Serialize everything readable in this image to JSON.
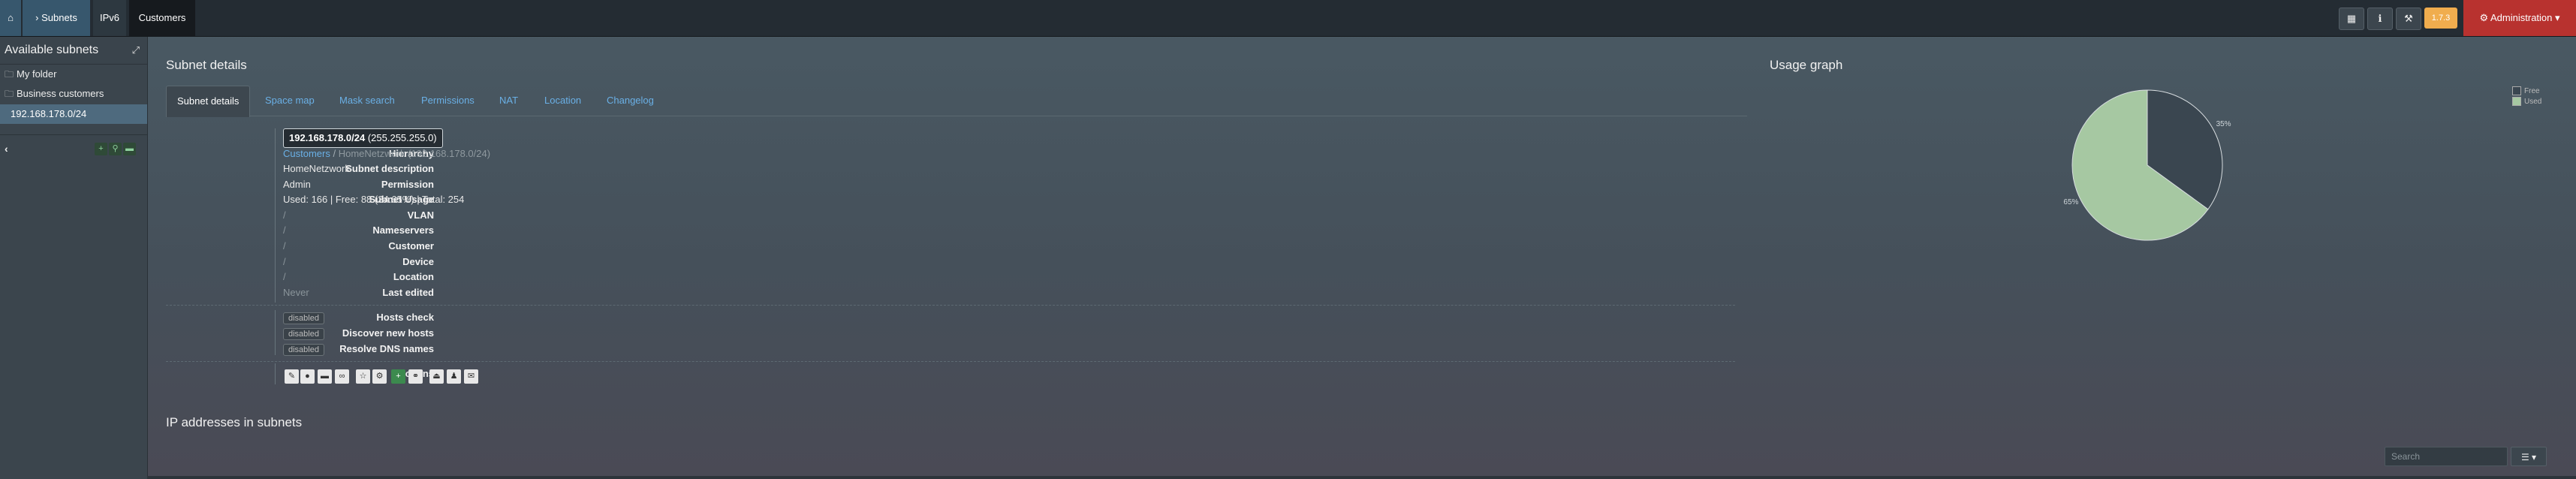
{
  "nav": {
    "home_icon": "home-icon",
    "subnets_label": "› Subnets",
    "ipv6_label": "IPv6",
    "customers_label": "Customers",
    "version_label": "1.7.3",
    "admin_label": "Administration ▾",
    "icons": [
      "grid-icon",
      "info-icon",
      "wrench-icon"
    ]
  },
  "sidebar": {
    "title": "Available subnets",
    "items": [
      {
        "label": "My folder",
        "icon": "folder-icon"
      },
      {
        "label": "Business customers",
        "icon": "folder-icon"
      },
      {
        "label": "192.168.178.0/24",
        "selected": true
      }
    ]
  },
  "details": {
    "title": "Subnet details",
    "tabs": [
      "Subnet details",
      "Space map",
      "Mask search",
      "Permissions",
      "NAT",
      "Location",
      "Changelog"
    ],
    "rows": {
      "subnet_details_label": "Subnet details",
      "cidr": "192.168.178.0/24",
      "mask": "(255.255.255.0)",
      "hierarchy_label": "Hierarchy",
      "hierarchy_link": "Customers",
      "hierarchy_sep": "/",
      "hierarchy_rest": "HomeNetzwork (192.168.178.0/24)",
      "description_label": "Subnet description",
      "description": "HomeNetzwork",
      "permission_label": "Permission",
      "permission": "Admin",
      "usage_label": "Subnet Usage",
      "usage": "Used: 166 | Free: 88 (34.65%) | Total: 254",
      "vlan_label": "VLAN",
      "vlan": "/",
      "nameservers_label": "Nameservers",
      "nameservers": "/",
      "customer_label": "Customer",
      "customer": "/",
      "device_label": "Device",
      "device": "/",
      "location_label": "Location",
      "location": "/",
      "last_edited_label": "Last edited",
      "last_edited": "Never",
      "hosts_check_label": "Hosts check",
      "hosts_check": "disabled",
      "discover_label": "Discover new hosts",
      "discover": "disabled",
      "resolve_label": "Resolve DNS names",
      "resolve": "disabled",
      "actions_label": "Actions"
    }
  },
  "usage_graph": {
    "title": "Usage graph",
    "legend": [
      "Free",
      "Used"
    ],
    "free_label": "35%",
    "used_label": "65%"
  },
  "chart_data": {
    "type": "pie",
    "title": "Usage graph",
    "categories": [
      "Free",
      "Used"
    ],
    "values": [
      35,
      65
    ],
    "colors": [
      "#3a4650",
      "#a6c8a2"
    ],
    "legend": "top-right"
  },
  "ip_section": {
    "title": "IP addresses in subnets",
    "search_placeholder": "Search"
  }
}
